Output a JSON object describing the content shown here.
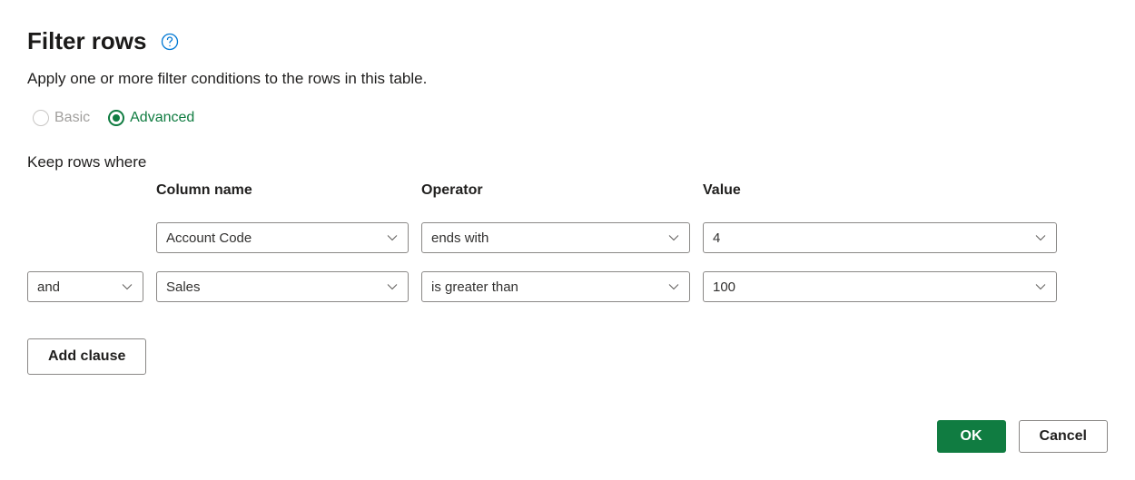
{
  "header": {
    "title": "Filter rows",
    "description": "Apply one or more filter conditions to the rows in this table."
  },
  "mode": {
    "basic_label": "Basic",
    "advanced_label": "Advanced"
  },
  "keep_label": "Keep rows where",
  "columns": {
    "column_name": "Column name",
    "operator": "Operator",
    "value": "Value"
  },
  "clauses": [
    {
      "logic": "",
      "column": "Account Code",
      "operator": "ends with",
      "value": "4"
    },
    {
      "logic": "and",
      "column": "Sales",
      "operator": "is greater than",
      "value": "100"
    }
  ],
  "buttons": {
    "add_clause": "Add clause",
    "ok": "OK",
    "cancel": "Cancel"
  }
}
